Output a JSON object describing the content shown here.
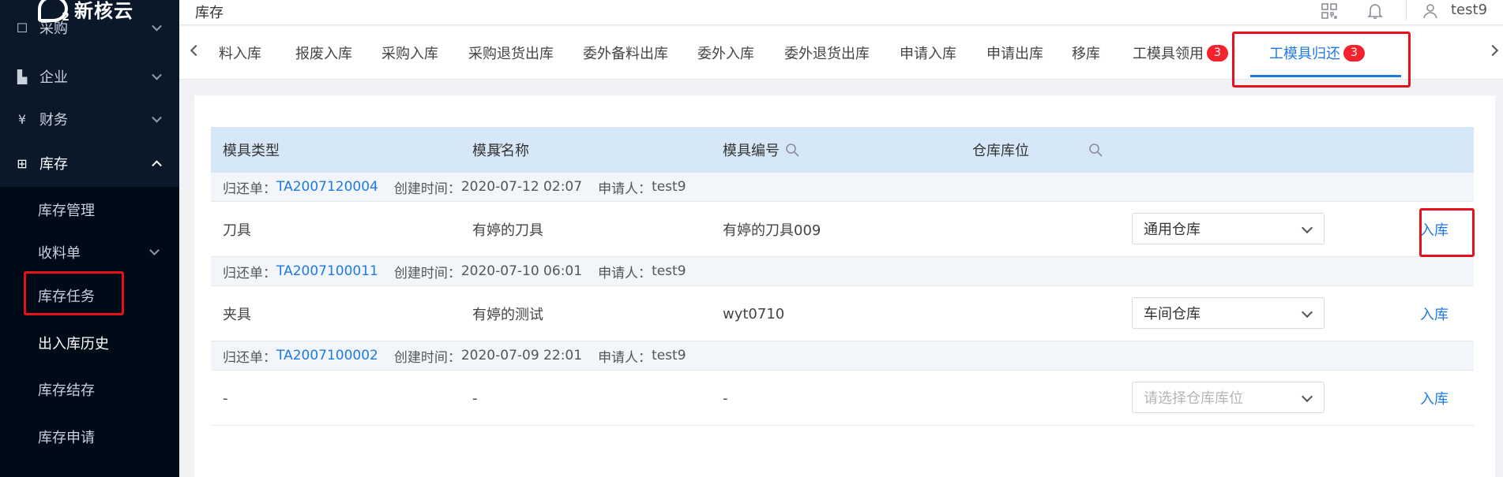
{
  "app": {
    "brand": "新核云"
  },
  "sidebar": {
    "items": [
      {
        "label": "采购",
        "icon": "purchase-icon"
      },
      {
        "label": "企业",
        "icon": "enterprise-icon"
      },
      {
        "label": "财务",
        "icon": "finance-icon"
      },
      {
        "label": "库存",
        "icon": "inventory-icon"
      }
    ],
    "submenu": [
      {
        "label": "库存管理"
      },
      {
        "label": "收料单"
      },
      {
        "label": "库存任务"
      },
      {
        "label": "出入库历史"
      },
      {
        "label": "库存结存"
      },
      {
        "label": "库存申请"
      }
    ]
  },
  "header": {
    "title": "库存",
    "user": "test9"
  },
  "tabs": [
    {
      "label": "料入库"
    },
    {
      "label": "报废入库"
    },
    {
      "label": "采购入库"
    },
    {
      "label": "采购退货出库"
    },
    {
      "label": "委外备料出库"
    },
    {
      "label": "委外入库"
    },
    {
      "label": "委外退货出库"
    },
    {
      "label": "申请入库"
    },
    {
      "label": "申请出库"
    },
    {
      "label": "移库"
    },
    {
      "label": "工模具领用",
      "badge": "3"
    },
    {
      "label": "工模具归还",
      "badge": "3"
    }
  ],
  "table": {
    "columns": [
      "模具类型",
      "模具名称",
      "模具编号",
      "仓库库位"
    ],
    "group_labels": {
      "order": "归还单：",
      "created": "创建时间：",
      "applicant": "申请人："
    },
    "groups": [
      {
        "order_no": "TA2007120004",
        "created_at": "2020-07-12 02:07",
        "applicant": "test9",
        "row": {
          "type": "刀具",
          "name": "有婷的刀具",
          "code": "有婷的刀具009",
          "warehouse": "通用仓库",
          "action": "入库"
        }
      },
      {
        "order_no": "TA2007100011",
        "created_at": "2020-07-10 06:01",
        "applicant": "test9",
        "row": {
          "type": "夹具",
          "name": "有婷的测试",
          "code": "wyt0710",
          "warehouse": "车间仓库",
          "action": "入库"
        }
      },
      {
        "order_no": "TA2007100002",
        "created_at": "2020-07-09 22:01",
        "applicant": "test9",
        "row": {
          "type": "-",
          "name": "-",
          "code": "-",
          "warehouse_placeholder": "请选择仓库库位",
          "action": "入库"
        }
      }
    ]
  }
}
